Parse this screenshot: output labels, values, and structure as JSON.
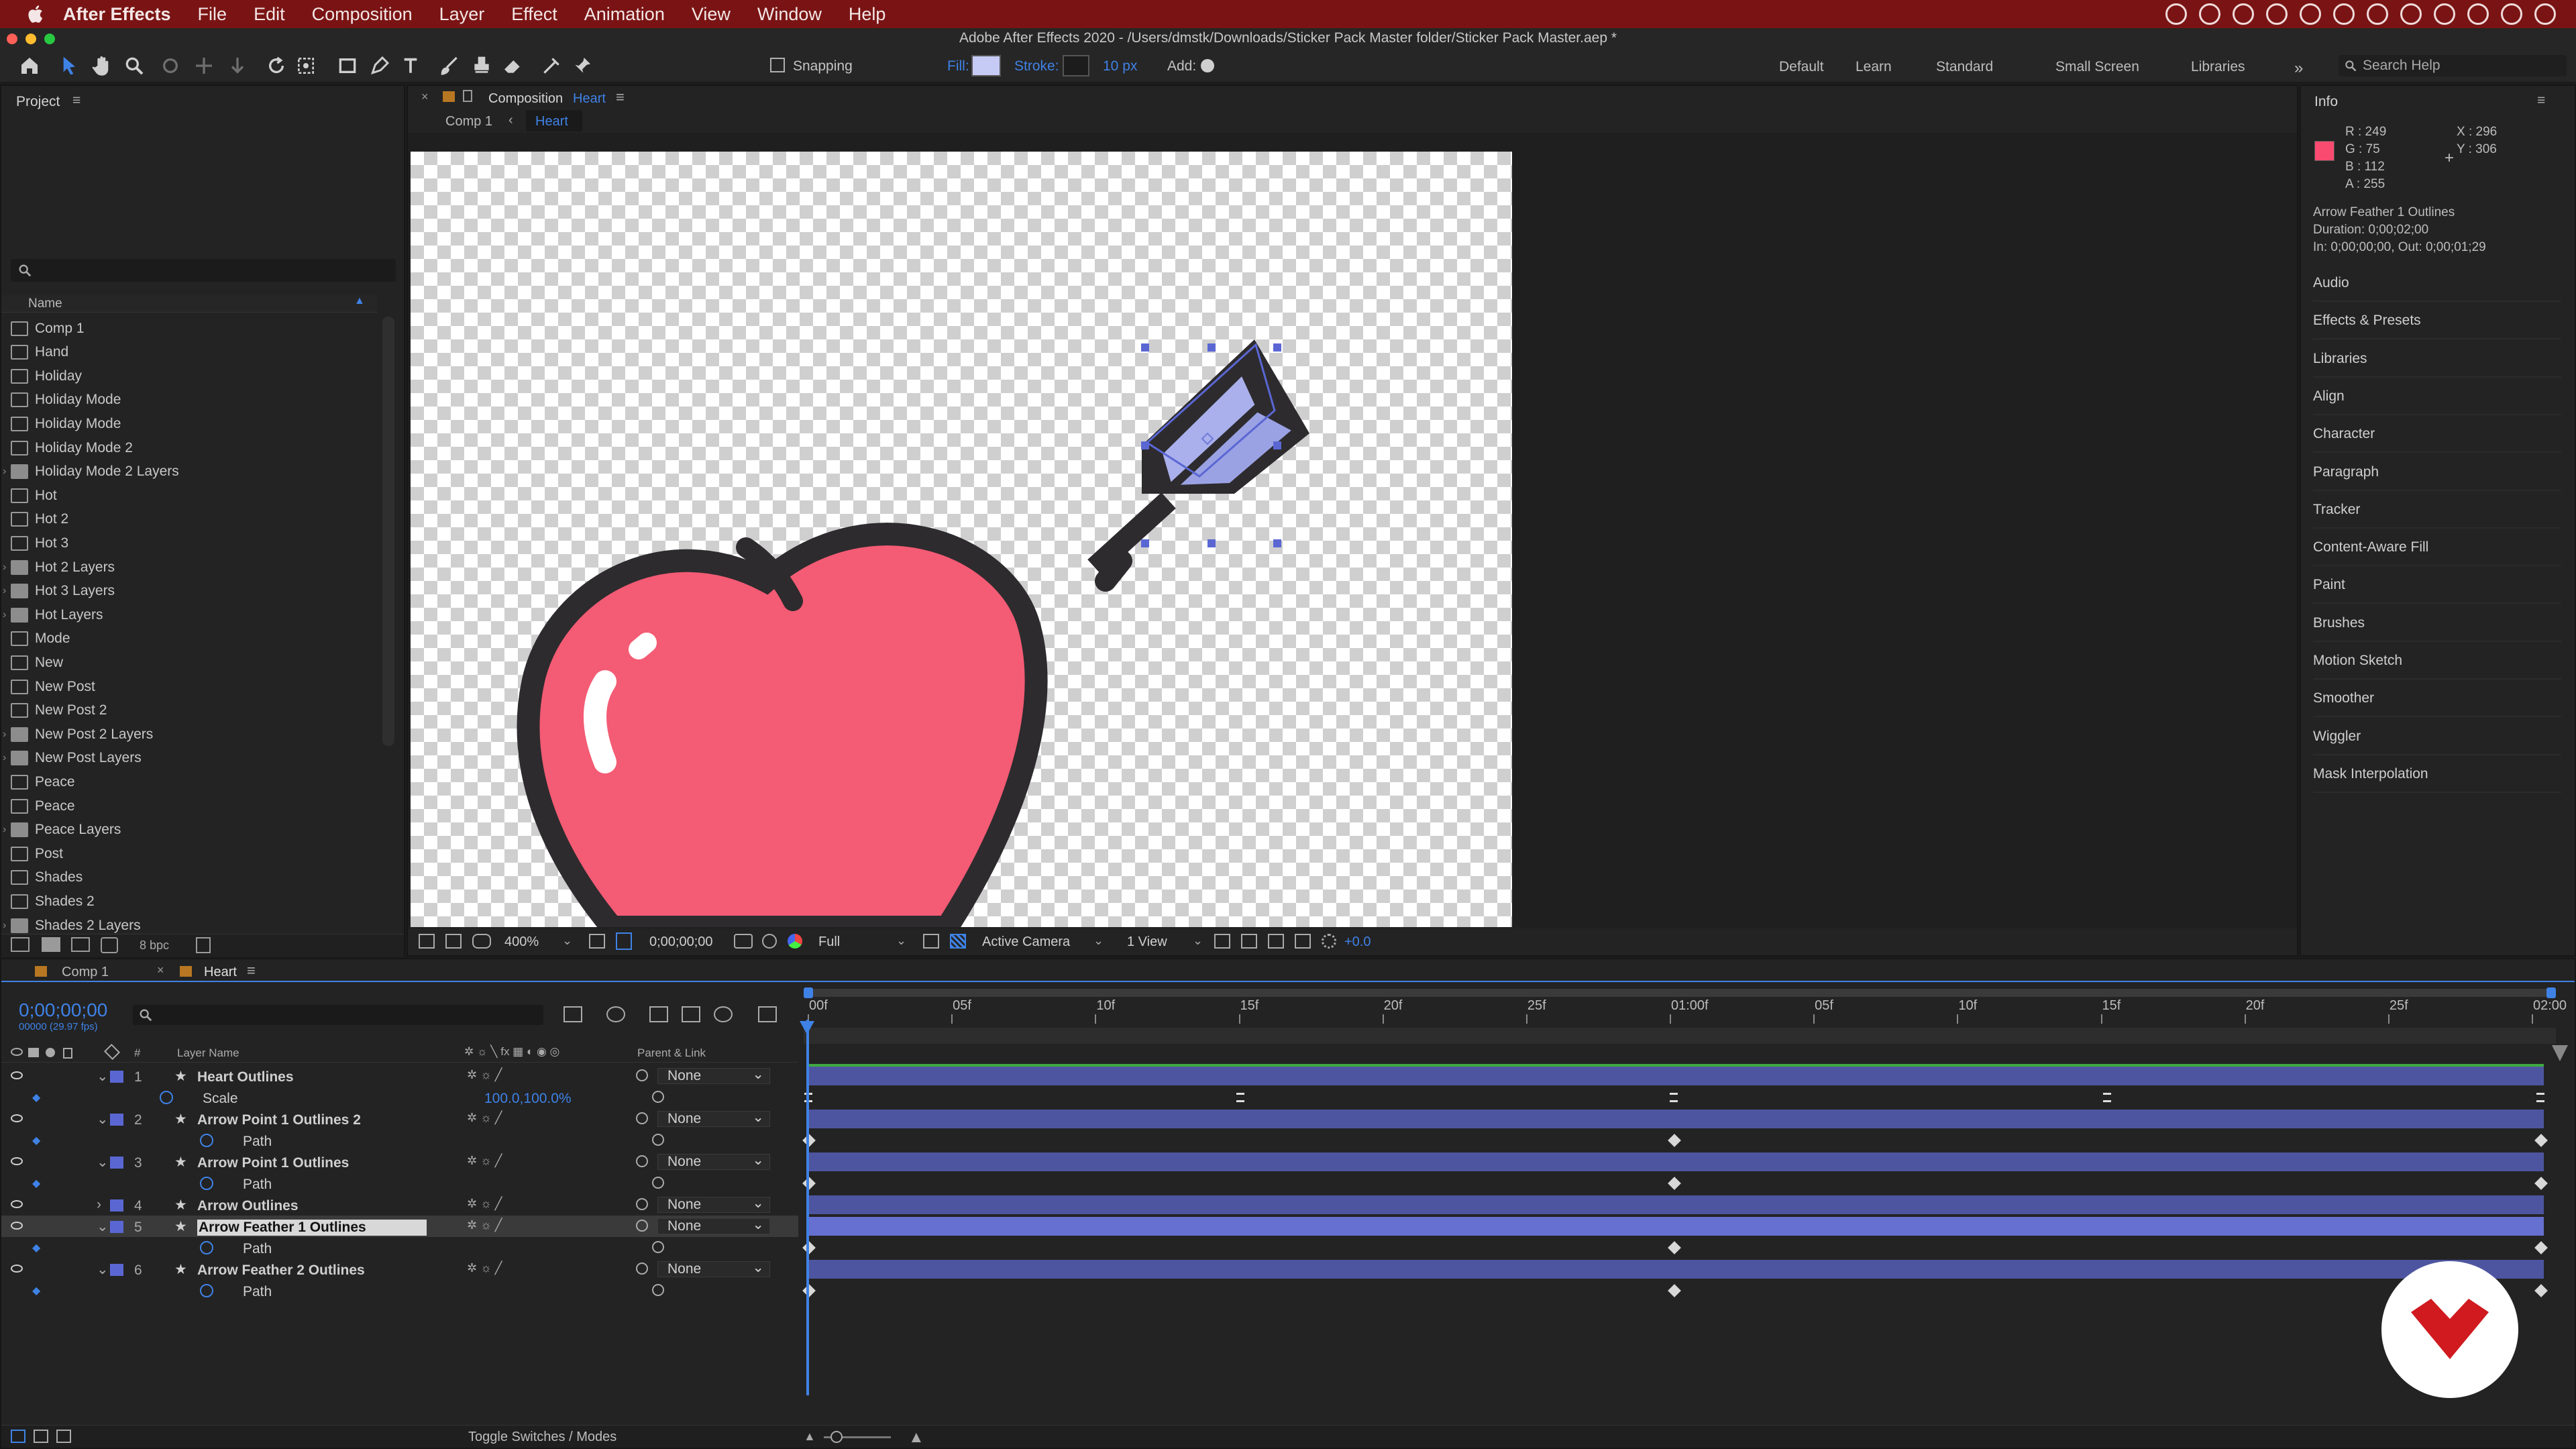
{
  "menubar": {
    "app": "After Effects",
    "items": [
      "File",
      "Edit",
      "Composition",
      "Layer",
      "Effect",
      "Animation",
      "View",
      "Window",
      "Help"
    ]
  },
  "titlebar": "Adobe After Effects 2020 - /Users/dmstk/Downloads/Sticker Pack Master folder/Sticker Pack Master.aep *",
  "toolbar": {
    "snapping": "Snapping",
    "fill": "Fill:",
    "stroke": "Stroke:",
    "stroke_px": "10 px",
    "add": "Add:",
    "workspaces": [
      "Default",
      "Learn",
      "Standard",
      "Small Screen",
      "Libraries"
    ],
    "search_placeholder": "Search Help"
  },
  "project": {
    "title": "Project",
    "col_name": "Name",
    "bpc": "8 bpc",
    "items": [
      {
        "label": "Comp 1",
        "type": "comp"
      },
      {
        "label": "Hand",
        "type": "comp"
      },
      {
        "label": "Holiday",
        "type": "comp"
      },
      {
        "label": "Holiday Mode",
        "type": "comp"
      },
      {
        "label": "Holiday Mode",
        "type": "comp"
      },
      {
        "label": "Holiday Mode 2",
        "type": "comp"
      },
      {
        "label": "Holiday Mode 2 Layers",
        "type": "folder"
      },
      {
        "label": "Hot",
        "type": "comp"
      },
      {
        "label": "Hot 2",
        "type": "comp"
      },
      {
        "label": "Hot 3",
        "type": "comp"
      },
      {
        "label": "Hot 2 Layers",
        "type": "folder"
      },
      {
        "label": "Hot 3 Layers",
        "type": "folder"
      },
      {
        "label": "Hot Layers",
        "type": "folder"
      },
      {
        "label": "Mode",
        "type": "comp"
      },
      {
        "label": "New",
        "type": "comp"
      },
      {
        "label": "New Post",
        "type": "comp"
      },
      {
        "label": "New Post 2",
        "type": "comp"
      },
      {
        "label": "New Post 2 Layers",
        "type": "folder"
      },
      {
        "label": "New Post Layers",
        "type": "folder"
      },
      {
        "label": "Peace",
        "type": "comp"
      },
      {
        "label": "Peace",
        "type": "comp"
      },
      {
        "label": "Peace Layers",
        "type": "folder"
      },
      {
        "label": "Post",
        "type": "comp"
      },
      {
        "label": "Shades",
        "type": "comp"
      },
      {
        "label": "Shades 2",
        "type": "comp"
      },
      {
        "label": "Shades 2 Layers",
        "type": "folder"
      }
    ]
  },
  "comp": {
    "tab_prefix": "Composition",
    "tab_name": "Heart",
    "breadcrumb": [
      "Comp 1",
      "Heart"
    ],
    "zoom": "400%",
    "timecode": "0;00;00;00",
    "resolution": "Full",
    "camera": "Active Camera",
    "views": "1 View",
    "exposure": "+0.0"
  },
  "info": {
    "title": "Info",
    "r": "R : 249",
    "g": "G : 75",
    "b": "B : 112",
    "a": "A : 255",
    "x": "X : 296",
    "y": "Y : 306",
    "swatch": "#f94b70",
    "layer": "Arrow Feather 1 Outlines",
    "duration": "Duration: 0;00;02;00",
    "inout": "In: 0;00;00;00, Out: 0;00;01;29"
  },
  "right_panels": [
    "Audio",
    "Effects & Presets",
    "Libraries",
    "Align",
    "Character",
    "Paragraph",
    "Tracker",
    "Content-Aware Fill",
    "Paint",
    "Brushes",
    "Motion Sketch",
    "Smoother",
    "Wiggler",
    "Mask Interpolation"
  ],
  "timeline": {
    "tabs": [
      "Comp 1",
      "Heart"
    ],
    "timecode": "0;00;00;00",
    "frames": "00000 (29.97 fps)",
    "col_layer": "Layer Name",
    "col_parent": "Parent & Link",
    "col_hash": "#",
    "ruler": [
      "00f",
      "05f",
      "10f",
      "15f",
      "20f",
      "25f",
      "01:00f",
      "05f",
      "10f",
      "15f",
      "20f",
      "25f",
      "02:00"
    ],
    "rows": [
      {
        "num": "1",
        "name": "Heart Outlines",
        "parent": "None",
        "kind": "layer"
      },
      {
        "name": "Scale",
        "value": "100.0,100.0%",
        "kind": "prop"
      },
      {
        "num": "2",
        "name": "Arrow Point 1 Outlines 2",
        "parent": "None",
        "kind": "layer"
      },
      {
        "name": "Path",
        "kind": "prop"
      },
      {
        "num": "3",
        "name": "Arrow Point 1 Outlines",
        "parent": "None",
        "kind": "layer"
      },
      {
        "name": "Path",
        "kind": "prop"
      },
      {
        "num": "4",
        "name": "Arrow Outlines",
        "parent": "None",
        "kind": "layer"
      },
      {
        "num": "5",
        "name": "Arrow Feather 1 Outlines",
        "parent": "None",
        "kind": "layer",
        "selected": true
      },
      {
        "name": "Path",
        "kind": "prop"
      },
      {
        "num": "6",
        "name": "Arrow Feather 2 Outlines",
        "parent": "None",
        "kind": "layer"
      },
      {
        "name": "Path",
        "kind": "prop"
      }
    ],
    "toggle": "Toggle Switches / Modes"
  },
  "colors": {
    "accent": "#3f82e6",
    "menubar": "#7a1414",
    "heart": "#f45b74",
    "label": "#5a67d3",
    "brand": "#d01a1f"
  }
}
